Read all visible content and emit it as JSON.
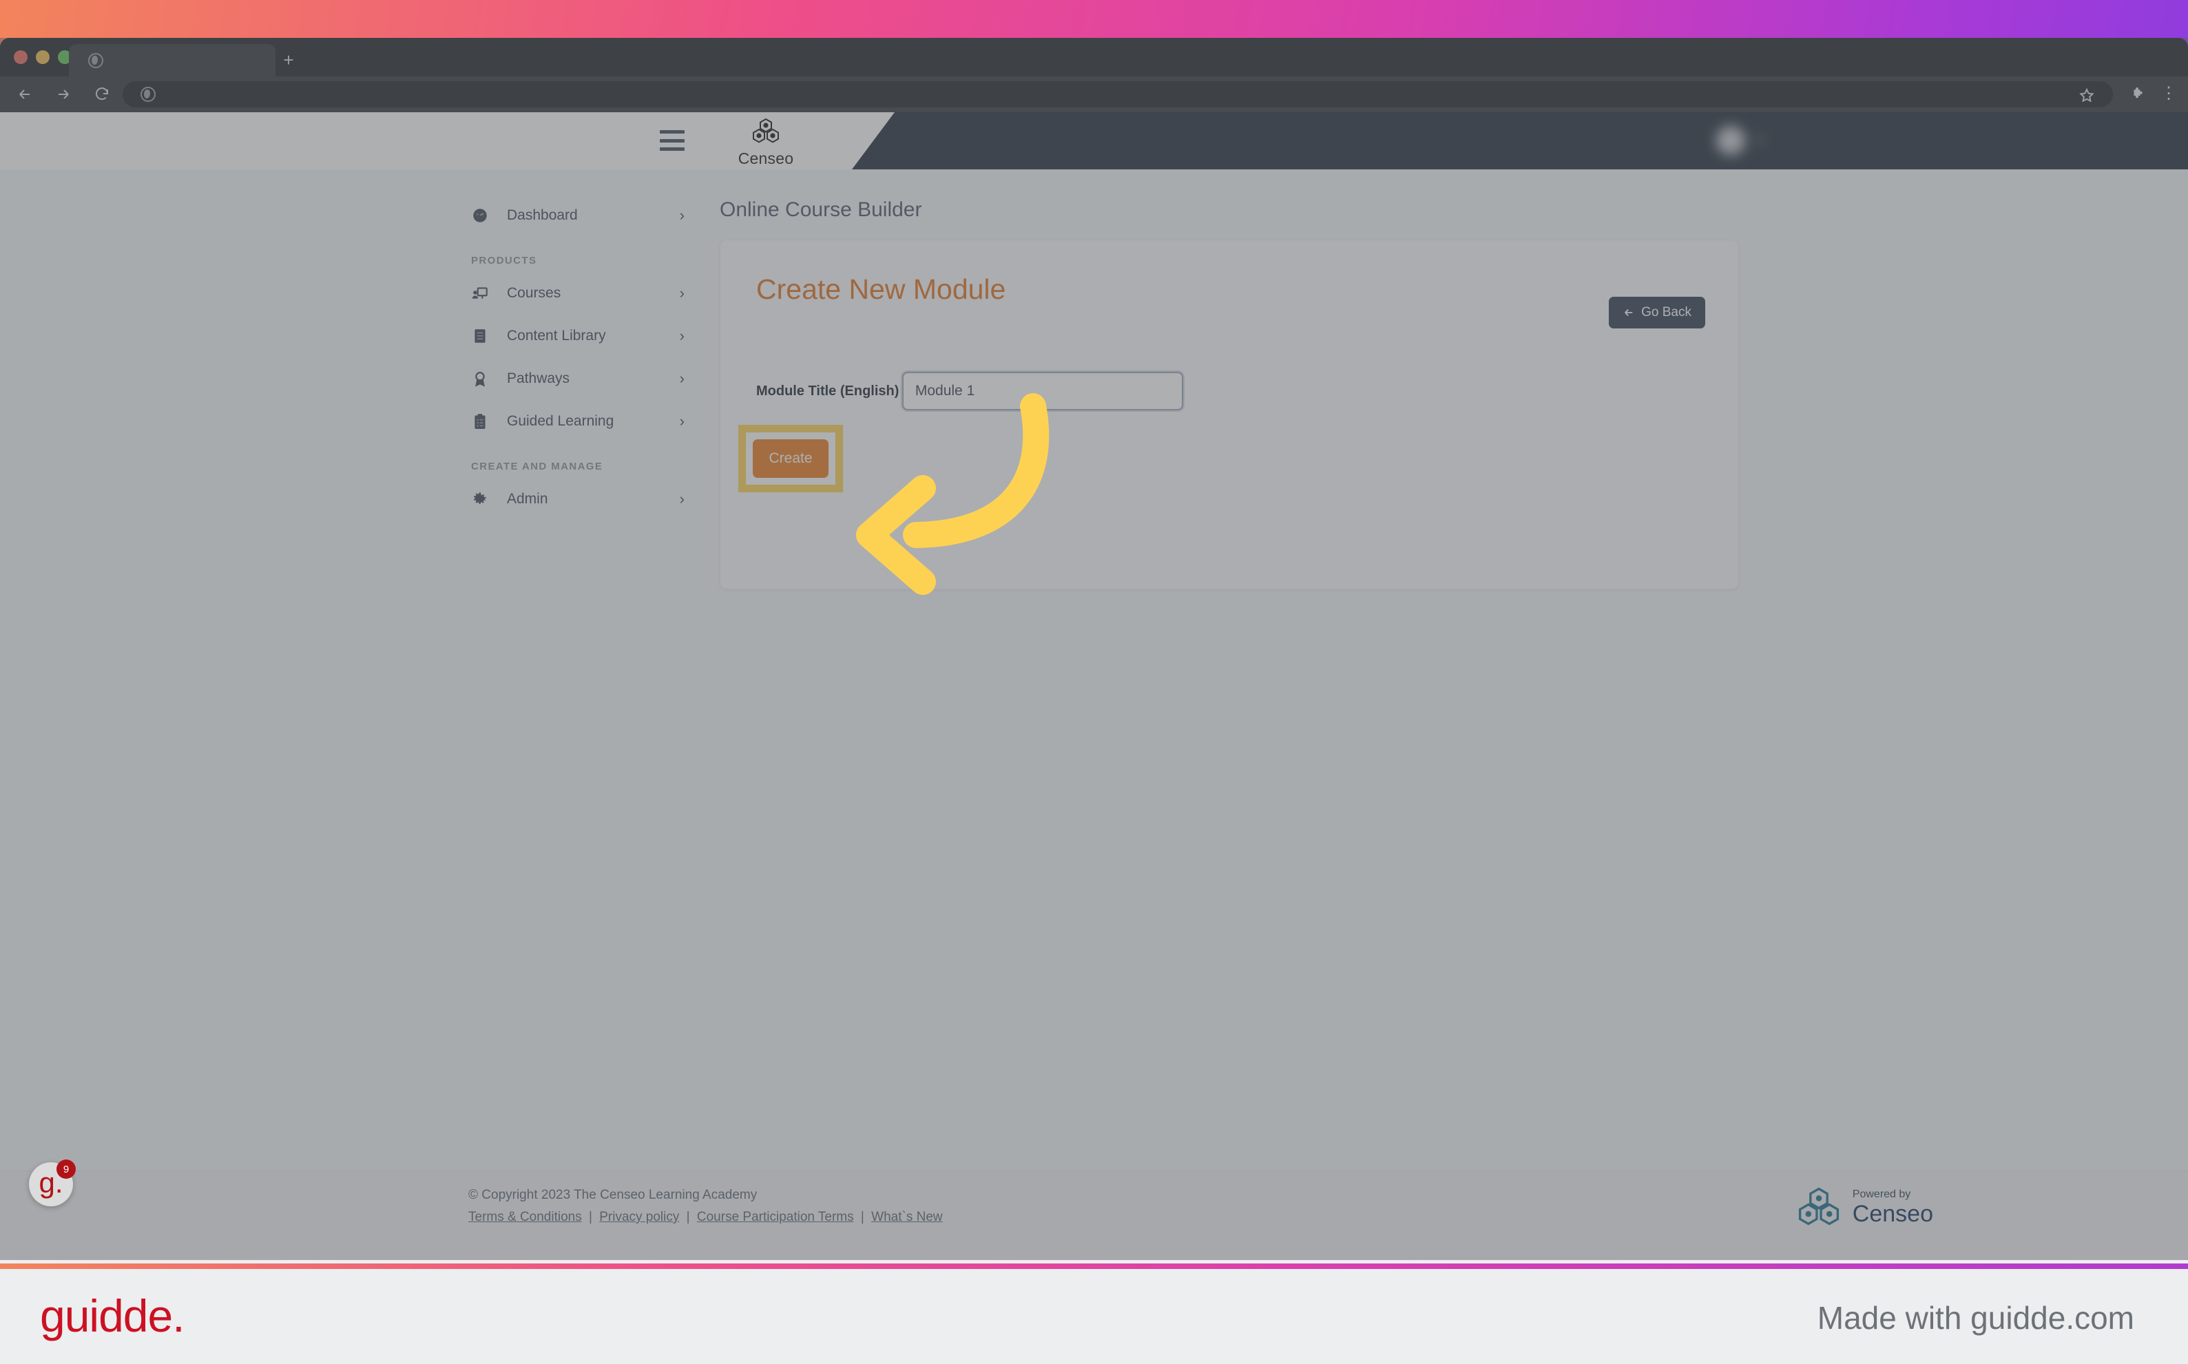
{
  "browser": {
    "tab_title": "",
    "new_tab_label": "+",
    "back_icon": "back-arrow-icon",
    "forward_icon": "forward-arrow-icon",
    "reload_icon": "reload-icon",
    "home_icon": "home-icon",
    "address_value": "",
    "bookmark_icon": "star-icon",
    "extensions_icon": "puzzle-icon",
    "menu_icon": "⋮"
  },
  "app_header": {
    "menu_icon": "hamburger-icon",
    "brand": "Censeo",
    "user_name": "",
    "avatar": "user-avatar"
  },
  "sidebar": {
    "items": [
      {
        "label": "Dashboard",
        "icon": "gauge-icon",
        "chevron": "›"
      }
    ],
    "sections": [
      {
        "title": "PRODUCTS",
        "items": [
          {
            "label": "Courses",
            "icon": "presentation-user-icon",
            "chevron": "›"
          },
          {
            "label": "Content Library",
            "icon": "book-icon",
            "chevron": "›"
          },
          {
            "label": "Pathways",
            "icon": "award-icon",
            "chevron": "›"
          },
          {
            "label": "Guided Learning",
            "icon": "clipboard-list-icon",
            "chevron": "›"
          }
        ]
      },
      {
        "title": "CREATE AND MANAGE",
        "items": [
          {
            "label": "Admin",
            "icon": "gear-icon",
            "chevron": "›"
          }
        ]
      }
    ]
  },
  "main": {
    "page_title": "Online Course Builder",
    "card": {
      "title": "Create New Module",
      "go_back_label": "Go Back",
      "go_back_icon": "left-arrow-icon",
      "field_label": "Module Title (English)",
      "field_value": "Module 1",
      "field_placeholder": "",
      "create_label": "Create"
    }
  },
  "footer": {
    "copyright": "© Copyright 2023 The Censeo Learning Academy",
    "links": [
      "Terms & Conditions",
      "Privacy policy",
      "Course Participation Terms",
      "What`s New"
    ],
    "separator": "|",
    "powered_by_small": "Powered by",
    "powered_by_brand": "Censeo"
  },
  "guidde": {
    "badge_letter": "g.",
    "badge_count": "9",
    "brand_logo": "guidde.",
    "tagline": "Made with guidde.com",
    "arrow": "curved-arrow-pointing-left"
  },
  "colors": {
    "accent_orange": "#ea7a1e",
    "heading_orange": "#e2711a",
    "dark_navy": "#222b38",
    "highlight_yellow": "#fdd253",
    "guidde_red": "#cc1122"
  }
}
